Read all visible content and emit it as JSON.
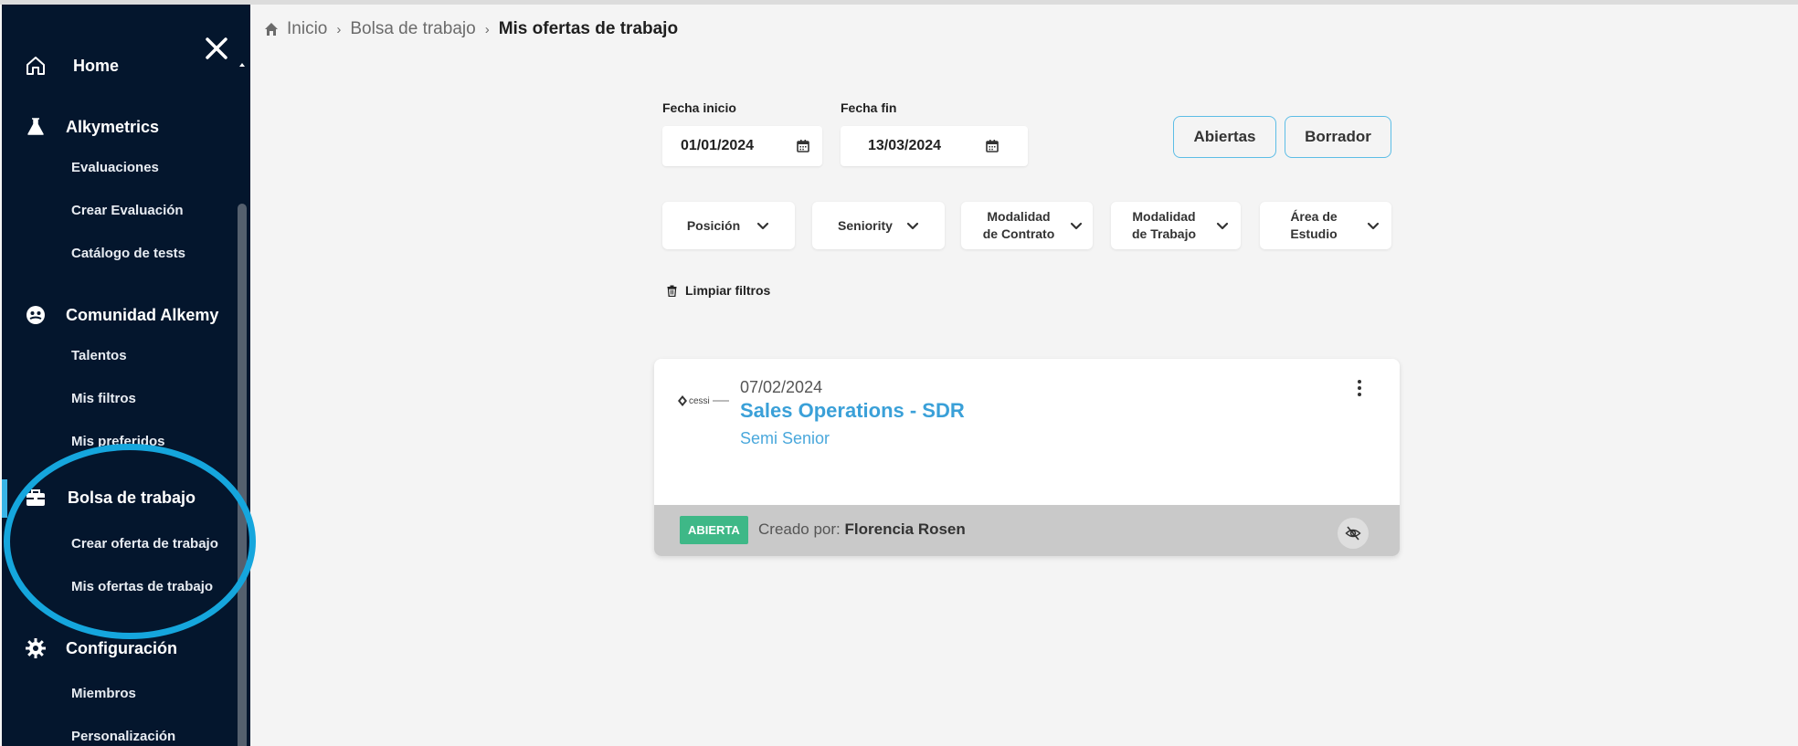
{
  "sidebar": {
    "home": "Home",
    "alkymetrics": {
      "title": "Alkymetrics",
      "items": [
        "Evaluaciones",
        "Crear Evaluación",
        "Catálogo de tests"
      ]
    },
    "comunidad": {
      "title": "Comunidad Alkemy",
      "items": [
        "Talentos",
        "Mis filtros",
        "Mis preferidos"
      ]
    },
    "bolsa": {
      "title": "Bolsa de trabajo",
      "items": [
        "Crear oferta de trabajo",
        "Mis ofertas de trabajo"
      ]
    },
    "config": {
      "title": "Configuración",
      "items": [
        "Miembros",
        "Personalización"
      ]
    }
  },
  "breadcrumb": {
    "inicio": "Inicio",
    "bolsa": "Bolsa de trabajo",
    "current": "Mis ofertas de trabajo"
  },
  "filters": {
    "fecha_inicio_label": "Fecha inicio",
    "fecha_inicio_value": "01/01/2024",
    "fecha_fin_label": "Fecha fin",
    "fecha_fin_value": "13/03/2024",
    "abiertas": "Abiertas",
    "borrador": "Borrador",
    "posicion": "Posición",
    "seniority": "Seniority",
    "modalidad_contrato": "Modalidad\nde Contrato",
    "modalidad_trabajo": "Modalidad\nde Trabajo",
    "area_estudio": "Área de\nEstudio",
    "limpiar": "Limpiar filtros"
  },
  "job": {
    "logo_text": "cessi",
    "date": "07/02/2024",
    "title": "Sales Operations - SDR",
    "seniority": "Semi Senior",
    "status": "ABIERTA",
    "created_by_label": "Creado por:",
    "created_by": "Florencia Rosen"
  },
  "colors": {
    "sidebar_bg": "#04162d",
    "accent": "#39b4e6",
    "link": "#3aa0d8",
    "badge_green": "#3eb887",
    "highlight_circle": "#15a6dd"
  }
}
